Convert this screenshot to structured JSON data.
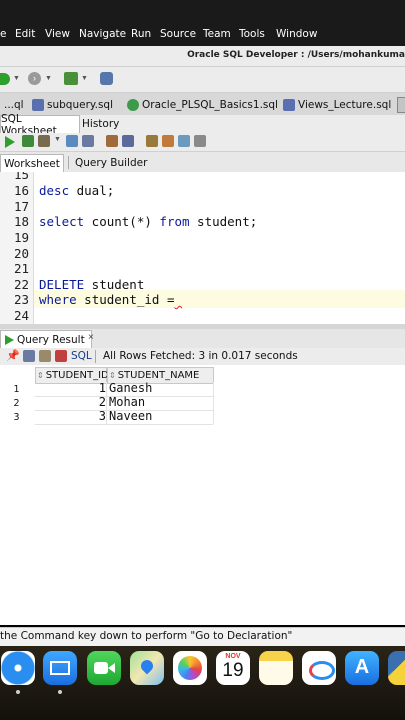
{
  "menubar": {
    "items": [
      "Edit",
      "View",
      "Navigate",
      "Run",
      "Source",
      "Team",
      "Tools",
      "Window"
    ]
  },
  "window": {
    "title": "Oracle SQL Developer : /Users/mohankuma"
  },
  "file_tabs": [
    {
      "label": "...ql"
    },
    {
      "label": "subquery.sql"
    },
    {
      "label": "Oracle_PLSQL_Basics1.sql"
    },
    {
      "label": "Views_Lecture.sql"
    }
  ],
  "worksheet_tabs": {
    "sql_worksheet": "SQL Worksheet",
    "history": "History"
  },
  "sub_tabs": {
    "worksheet": "Worksheet",
    "query_builder": "Query Builder"
  },
  "editor": {
    "lines": [
      {
        "num": "15",
        "code": ""
      },
      {
        "num": "16",
        "kw": "desc",
        "rest": " dual;"
      },
      {
        "num": "17",
        "code": ""
      },
      {
        "num": "18",
        "kw": "select",
        "mid": " count(*) ",
        "kw2": "from",
        "rest": " student;"
      },
      {
        "num": "19",
        "code": ""
      },
      {
        "num": "20",
        "code": ""
      },
      {
        "num": "21",
        "code": ""
      },
      {
        "num": "22",
        "kw": "DELETE",
        "rest": " student"
      },
      {
        "num": "23",
        "kw": "where",
        "rest": " student_id =",
        "squig": "_"
      },
      {
        "num": "24",
        "code": ""
      }
    ]
  },
  "query_result": {
    "tab_label": "Query Result",
    "sql_label": "SQL",
    "status": "All Rows Fetched: 3 in 0.017 seconds",
    "columns": [
      "STUDENT_ID",
      "STUDENT_NAME"
    ],
    "rows": [
      {
        "num": "1",
        "id": "1",
        "name": "Ganesh"
      },
      {
        "num": "2",
        "id": "2",
        "name": "Mohan"
      },
      {
        "num": "3",
        "id": "3",
        "name": "Naveen"
      }
    ]
  },
  "status_bar": {
    "text": "the Command key down to perform \"Go to Declaration\""
  },
  "dock": {
    "calendar_month": "NOV",
    "calendar_day": "19",
    "apps": [
      "safari-icon",
      "mail-icon",
      "facetime-icon",
      "maps-icon",
      "photos-icon",
      "calendar-icon",
      "notes-icon",
      "freeform-icon",
      "app-store-icon",
      "python-icon"
    ]
  },
  "colors": {
    "keyword": "#0a1a9a",
    "run_green": "#2e9e2e",
    "current_line": "#fdfbe0"
  }
}
